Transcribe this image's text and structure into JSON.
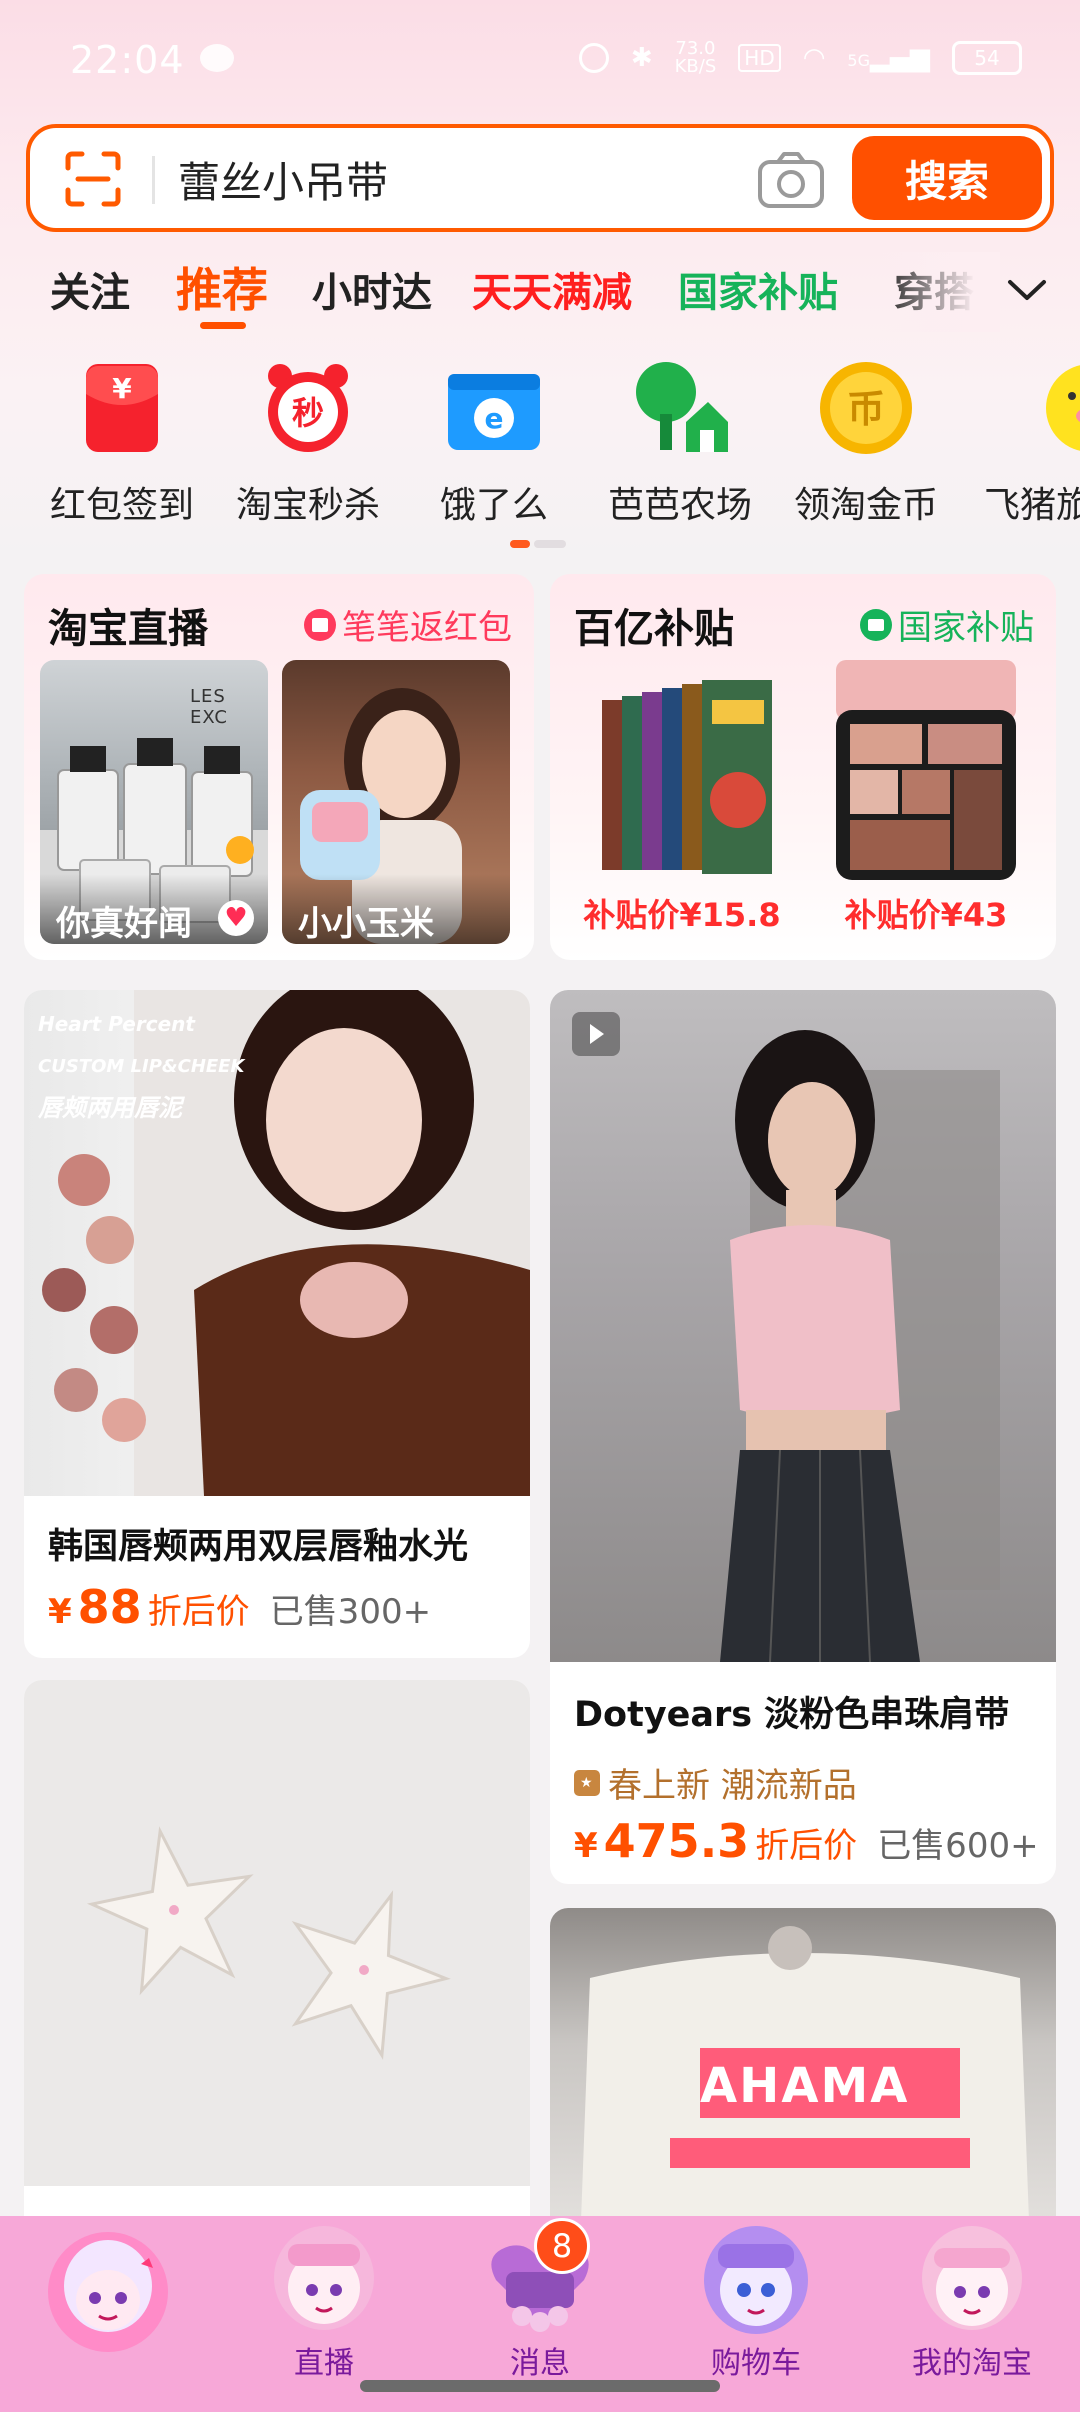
{
  "status_bar": {
    "time": "22:04",
    "network_speed": "73.0\nKB/S",
    "hd": "HD",
    "signal": "5G",
    "battery": "54"
  },
  "search": {
    "value": "蕾丝小吊带",
    "button_label": "搜索"
  },
  "tabs": [
    {
      "label": "关注",
      "color": "#222222"
    },
    {
      "label": "推荐",
      "color": "#ff5000",
      "active": true
    },
    {
      "label": "小时达",
      "color": "#222222"
    },
    {
      "label": "天天满减",
      "color": "#ff1f1f"
    },
    {
      "label": "国家补贴",
      "color": "#16b35a"
    },
    {
      "label": "穿搭",
      "color": "#222222"
    }
  ],
  "quick_icons": [
    {
      "label": "红包签到",
      "icon": "red-envelope-icon"
    },
    {
      "label": "淘宝秒杀",
      "icon": "alarm-clock-icon",
      "glyph": "秒"
    },
    {
      "label": "饿了么",
      "icon": "eleme-icon",
      "glyph": "e"
    },
    {
      "label": "芭芭农场",
      "icon": "farm-tree-icon"
    },
    {
      "label": "领淘金币",
      "icon": "gold-coin-icon",
      "glyph": "币"
    },
    {
      "label": "飞猪旅",
      "icon": "fliggy-pig-icon"
    }
  ],
  "live_card": {
    "title": "淘宝直播",
    "tag": "笔笔返红包",
    "streams": [
      {
        "name": "你真好闻"
      },
      {
        "name": "小小玉米"
      }
    ],
    "perfume_brand": "LES EXC"
  },
  "subsidy_card": {
    "title": "百亿补贴",
    "tag": "国家补贴",
    "items": [
      {
        "price": "补贴价¥15.8"
      },
      {
        "price": "补贴价¥43"
      }
    ]
  },
  "products": {
    "lip": {
      "brand_line1": "Heart Percent",
      "brand_line2": "CUSTOM LIP&CHEEK",
      "brand_line3": "唇颊两用唇泥",
      "title": "韩国唇颊两用双层唇釉水光",
      "yen": "¥",
      "price": "88",
      "price_label": "折后价",
      "sold": "已售300+"
    },
    "top": {
      "title": "Dotyears 淡粉色串珠肩带",
      "tag": "春上新 潮流新品",
      "yen": "¥",
      "price": "475.3",
      "price_label": "折后价",
      "sold": "已售600+"
    },
    "sweater": {
      "print": "AHAMA"
    }
  },
  "bottom_nav": [
    {
      "label": "",
      "icon": "home-face-icon"
    },
    {
      "label": "直播",
      "icon": "live-face-icon"
    },
    {
      "label": "消息",
      "icon": "message-face-icon",
      "badge": "8"
    },
    {
      "label": "购物车",
      "icon": "cart-face-icon"
    },
    {
      "label": "我的淘宝",
      "icon": "profile-face-icon"
    }
  ]
}
